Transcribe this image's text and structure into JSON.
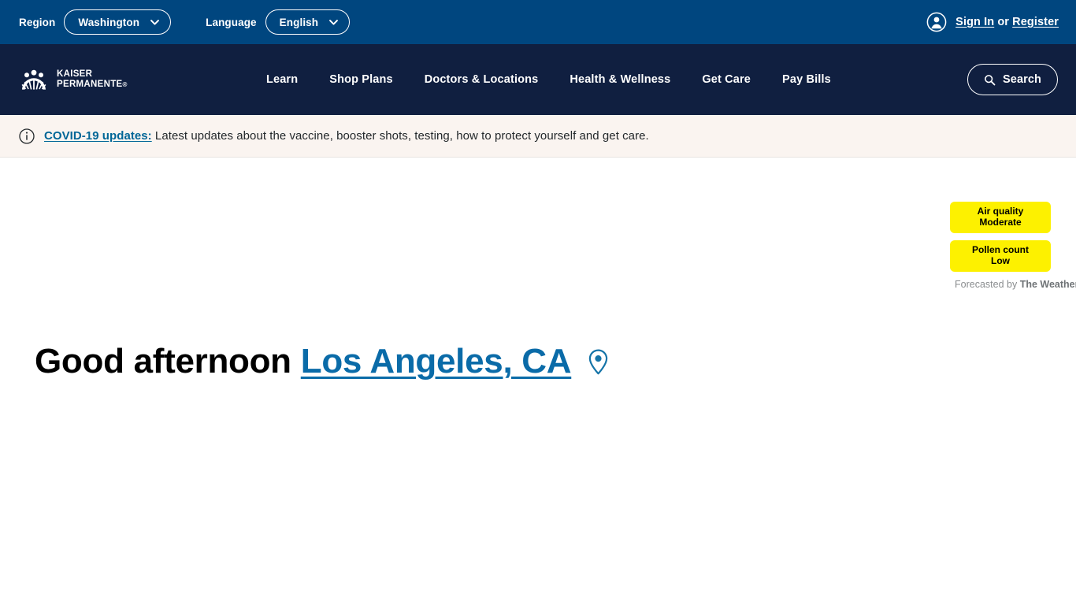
{
  "topbar": {
    "region_label": "Region",
    "region_value": "Washington",
    "language_label": "Language",
    "language_value": "English",
    "sign_in": "Sign In",
    "or": " or ",
    "register": "Register",
    "account_icon": "account-circle-icon",
    "chevron_icon": "chevron-down-icon",
    "background_color": "#00467f"
  },
  "nav": {
    "logo_line1": "KAISER",
    "logo_line2": "PERMANENTE",
    "logo_registered": "®",
    "logo_icon": "kaiser-permanente-thrive-logo",
    "links": [
      {
        "label": "Learn"
      },
      {
        "label": "Shop Plans"
      },
      {
        "label": "Doctors & Locations"
      },
      {
        "label": "Health & Wellness"
      },
      {
        "label": "Get Care"
      },
      {
        "label": "Pay Bills"
      }
    ],
    "search_label": "Search",
    "search_icon": "search-icon",
    "background_color": "#101f40"
  },
  "banner": {
    "icon": "info-circle-icon",
    "link_text": "COVID-19 updates:",
    "body_text": " Latest updates about the vaccine, booster shots, testing, how to protect yourself and get care.",
    "background_color": "#faf4f0",
    "link_color": "#006697"
  },
  "main": {
    "greeting": "Good afternoon",
    "location": "Los Angeles, CA",
    "location_icon": "map-pin-icon",
    "location_color": "#0a6ba8"
  },
  "weather": {
    "badges": [
      {
        "title": "Air quality",
        "value": "Moderate"
      },
      {
        "title": "Pollen count",
        "value": "Low"
      }
    ],
    "attribution_prefix": "Forecasted by ",
    "attribution_brand": "The Weather Channel®",
    "badge_color": "#fdf100"
  }
}
